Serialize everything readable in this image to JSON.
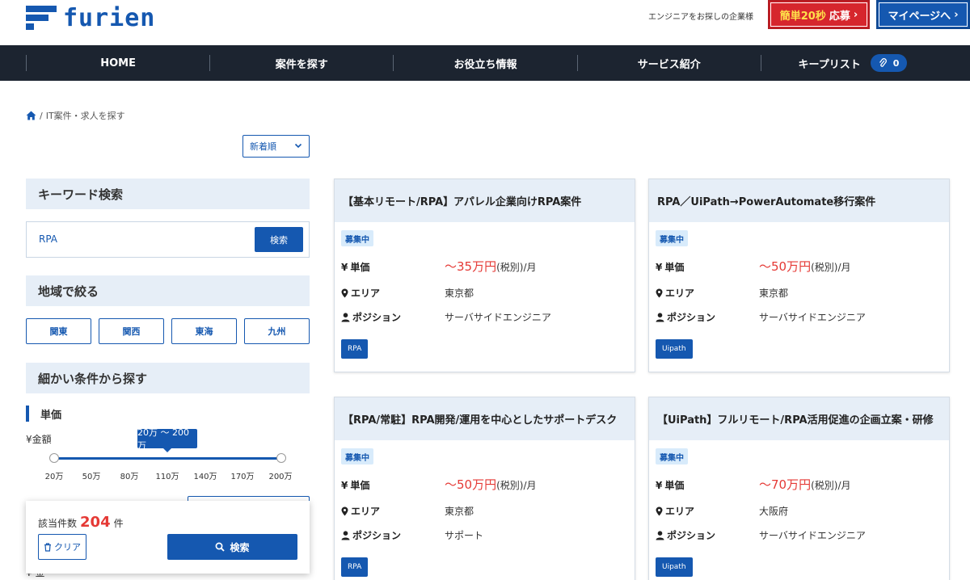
{
  "header": {
    "logo_text": "furien",
    "company_note": "エンジニアをお探しの企業様",
    "apply_prefix": "簡単20秒",
    "apply_label": "応募",
    "mypage_label": "マイページへ",
    "chevron": "›"
  },
  "nav": {
    "items": [
      {
        "label": "HOME"
      },
      {
        "label": "案件を探す"
      },
      {
        "label": "お役立ち情報"
      },
      {
        "label": "サービス紹介"
      },
      {
        "label": "キープリスト"
      }
    ],
    "keep_count": "0"
  },
  "breadcrumb": {
    "current": "IT案件・求人を探す",
    "separator": "/"
  },
  "sort": {
    "selected": "新着順"
  },
  "sidebar": {
    "keyword_heading": "キーワード検索",
    "keyword_value": "RPA",
    "keyword_button": "検索",
    "region_heading": "地域で絞る",
    "regions": [
      "関東",
      "関西",
      "東海",
      "九州"
    ],
    "detail_heading": "細かい条件から探す",
    "price_heading": "単価",
    "amount_label": "¥金額",
    "slider_tooltip": "20万 〜 200万",
    "slider_ticks": [
      "20万",
      "50万",
      "80万",
      "110万",
      "140万",
      "170万",
      "200万"
    ],
    "slider_range": [
      20,
      200
    ],
    "result_label": "該当件数",
    "result_count": "204",
    "result_unit": "件",
    "clear_label": "クリア",
    "search_label": "検索",
    "bottom_peek": "¥ 金"
  },
  "job_labels": {
    "price": "単価",
    "area": "エリア",
    "position": "ポジション",
    "price_suffix": "(税別)/月"
  },
  "jobs": [
    {
      "title": "【基本リモート/RPA】アパレル企業向けRPA案件",
      "status": "募集中",
      "price": "〜35万円",
      "area": "東京都",
      "position": "サーバサイドエンジニア",
      "tag": "RPA"
    },
    {
      "title": "RPA／UiPath→PowerAutomate移行案件",
      "status": "募集中",
      "price": "〜50万円",
      "area": "東京都",
      "position": "サーバサイドエンジニア",
      "tag": "Uipath"
    },
    {
      "title": "【RPA/常駐】RPA開発/運用を中心としたサポートデスク",
      "status": "募集中",
      "price": "〜50万円",
      "area": "東京都",
      "position": "サポート",
      "tag": "RPA"
    },
    {
      "title": "【UiPath】フルリモート/RPA活用促進の企画立案・研修",
      "status": "募集中",
      "price": "〜70万円",
      "area": "大阪府",
      "position": "サーバサイドエンジニア",
      "tag": "Uipath"
    }
  ],
  "colors": {
    "brand_blue": "#1558b0",
    "nav_bg": "#1c2430",
    "apply_red": "#d6262d",
    "price_red": "#e53935",
    "panel_bg": "#e6eef7"
  }
}
